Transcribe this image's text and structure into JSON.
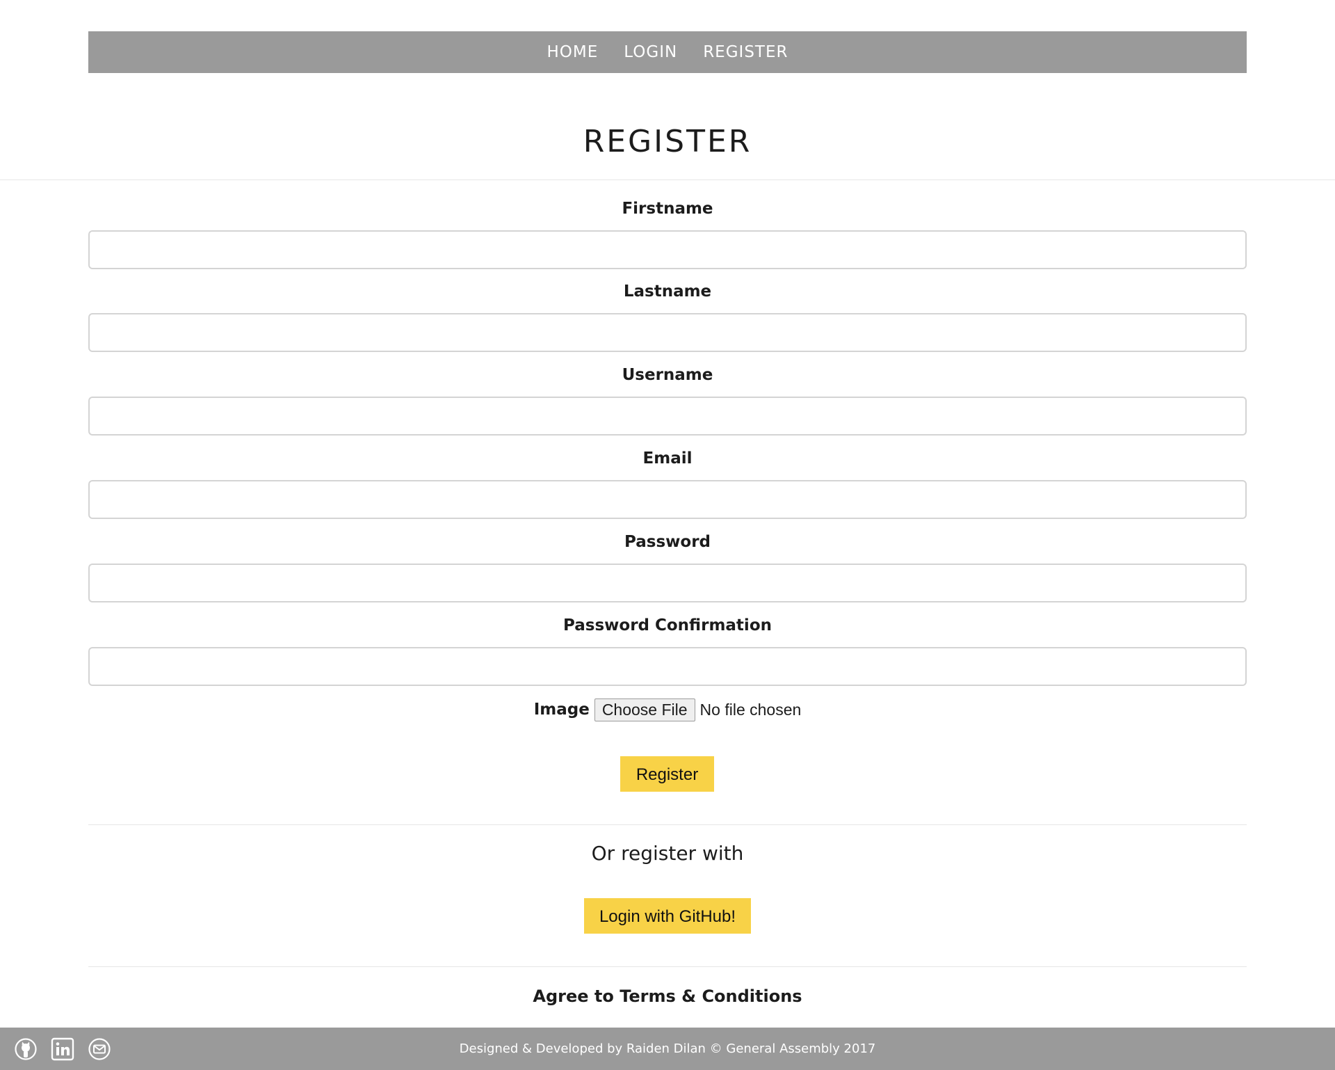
{
  "nav": {
    "home": "HOME",
    "login": "LOGIN",
    "register": "REGISTER"
  },
  "page_title": "REGISTER",
  "form": {
    "firstname_label": "Firstname",
    "lastname_label": "Lastname",
    "username_label": "Username",
    "email_label": "Email",
    "password_label": "Password",
    "password_confirmation_label": "Password Confirmation",
    "image_label": "Image",
    "file_button_label": "Choose File",
    "file_status": "No file chosen",
    "submit_label": "Register"
  },
  "social": {
    "heading": "Or register with",
    "github_button_label": "Login with GitHub!"
  },
  "terms_label": "Agree to Terms & Conditions",
  "footer": {
    "icons": [
      "github-icon",
      "linkedin-icon",
      "email-icon"
    ],
    "credit": "Designed & Developed by Raiden Dilan © General Assembly 2017"
  },
  "colors": {
    "nav_background": "#9a9a9a",
    "footer_background": "#9a9a9a",
    "button_yellow": "#f8d247",
    "text_dark": "#1c1c1c"
  }
}
